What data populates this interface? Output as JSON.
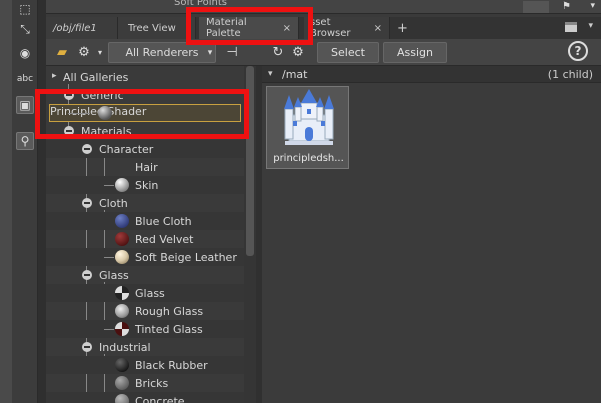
{
  "top_strip": {
    "label": "Soft Points"
  },
  "tabs": [
    {
      "label": "/obj/file1",
      "active": false
    },
    {
      "label": "Tree View",
      "active": false
    },
    {
      "label": "Material Palette",
      "active": true,
      "close": "×"
    },
    {
      "label": "sset Browser",
      "active": false,
      "close": "×"
    }
  ],
  "tab_add": "+",
  "toolbar": {
    "renderers": "All Renderers",
    "select": "Select",
    "assign": "Assign",
    "help": "?"
  },
  "tree": {
    "root": "All Galleries",
    "generic": "Generic",
    "principled": "Principled Shader",
    "materials": "Materials",
    "character": "Character",
    "hair": "Hair",
    "skin": "Skin",
    "cloth": "Cloth",
    "blue_cloth": "Blue Cloth",
    "red_velvet": "Red Velvet",
    "soft_beige_leather": "Soft Beige Leather",
    "glass_group": "Glass",
    "glass": "Glass",
    "rough_glass": "Rough Glass",
    "tinted_glass": "Tinted Glass",
    "industrial": "Industrial",
    "black_rubber": "Black Rubber",
    "bricks": "Bricks",
    "concrete": "Concrete"
  },
  "right": {
    "path": "/mat",
    "count": "(1 child)",
    "item_label": "principledsh..."
  },
  "tool_abc": "abc",
  "colors": {
    "callout": "#ee1111",
    "selection_border": "#c8a040"
  }
}
